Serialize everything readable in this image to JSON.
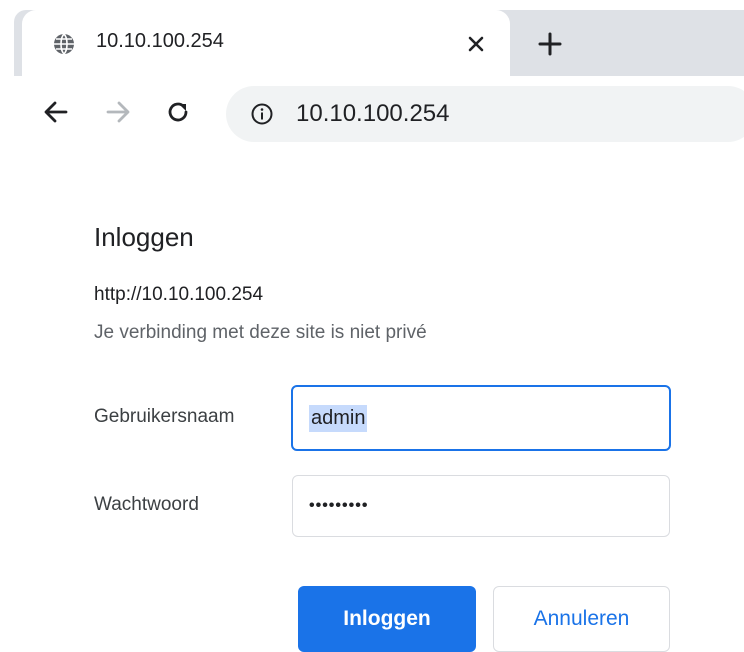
{
  "tab": {
    "title": "10.10.100.254",
    "favicon": "globe-icon",
    "close_glyph": "×",
    "new_tab_glyph": "+"
  },
  "toolbar": {
    "back_icon": "back-arrow-icon",
    "forward_icon": "forward-arrow-icon",
    "reload_icon": "reload-icon",
    "info_icon": "info-icon",
    "url": "10.10.100.254"
  },
  "dialog": {
    "title": "Inloggen",
    "origin": "http://10.10.100.254",
    "warning": "Je verbinding met deze site is niet privé",
    "username_label": "Gebruikersnaam",
    "username_value": "admin",
    "password_label": "Wachtwoord",
    "password_value": "•••••••••",
    "login_button": "Inloggen",
    "cancel_button": "Annuleren"
  },
  "colors": {
    "accent": "#1a73e8",
    "tabstrip": "#dee1e6",
    "omnibox": "#f1f3f4",
    "selection": "#c6dafc"
  }
}
